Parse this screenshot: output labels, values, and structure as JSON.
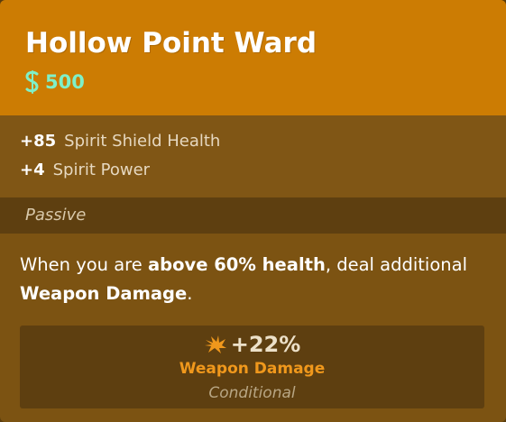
{
  "item": {
    "name": "Hollow Point Ward",
    "cost": "500",
    "colors": {
      "header": "#cc7c03",
      "cost": "#7ff0c8",
      "weapon_accent": "#f0981c"
    }
  },
  "stats": [
    {
      "value": "+85",
      "label": "Spirit Shield Health"
    },
    {
      "value": "+4",
      "label": "Spirit Power"
    }
  ],
  "passive": {
    "label": "Passive",
    "description": {
      "part1": "When you are ",
      "bold1": "above 60% health",
      "part2": ", deal additional ",
      "bold2": "Weapon Damage",
      "part3": "."
    }
  },
  "effect": {
    "icon": "weapon-damage-icon",
    "value": "+22%",
    "name": "Weapon Damage",
    "condition": "Conditional"
  }
}
